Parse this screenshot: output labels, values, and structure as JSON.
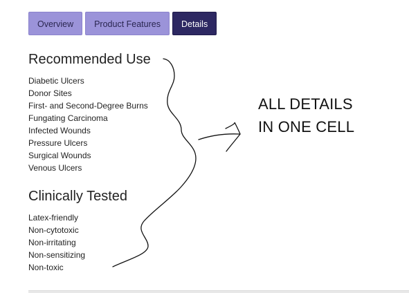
{
  "tabs": [
    {
      "label": "Overview"
    },
    {
      "label": "Product Features"
    },
    {
      "label": "Details"
    }
  ],
  "recommended_use": {
    "title": "Recommended Use",
    "items": [
      "Diabetic Ulcers",
      "Donor Sites",
      "First- and Second-Degree Burns",
      "Fungating Carcinoma",
      "Infected Wounds",
      "Pressure Ulcers",
      "Surgical Wounds",
      "Venous Ulcers"
    ]
  },
  "clinically_tested": {
    "title": "Clinically Tested",
    "items": [
      "Latex-friendly",
      "Non-cytotoxic",
      "Non-irritating",
      "Non-sensitizing",
      "Non-toxic"
    ]
  },
  "annotation": {
    "line1": "ALL DETAILS",
    "line2": "IN ONE CELL"
  },
  "colors": {
    "tab_inactive": "#9b93d9",
    "tab_active": "#2d2862"
  }
}
